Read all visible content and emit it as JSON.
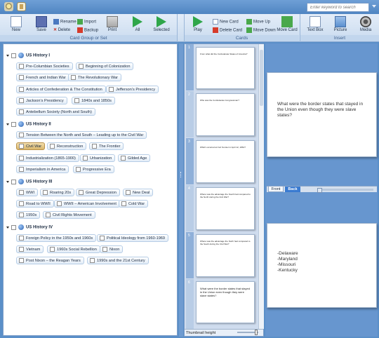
{
  "titlebar": {
    "search_placeholder": "Enter keyword to search"
  },
  "ribbon": {
    "card_group": {
      "label": "Card Group or Set",
      "new": "New",
      "save": "Save",
      "rename": "Rename",
      "delete": "Delete",
      "import": "Import",
      "backup": "Backup",
      "print": "Print",
      "all": "All",
      "selected": "Selected"
    },
    "cards": {
      "label": "Cards",
      "play": "Play",
      "new_card": "New Card",
      "delete_card": "Delete Card",
      "move_up": "Move Up",
      "move_down": "Move Down",
      "move_card": "Move Card"
    },
    "insert": {
      "label": "Insert",
      "text_box": "Text Box",
      "picture": "Picture",
      "media": "Media"
    }
  },
  "groups": [
    {
      "title": "US History I",
      "items": [
        "Pre-Columbian Societies",
        "Beginning of Colonization",
        "French and Indian War",
        "The Revolutionary War",
        "Articles of Confederation & The Constitution",
        "Jefferson's Presidency",
        "Jackson's Presidency",
        "1840s and 1850s",
        "Antebellum Society (North and South)"
      ]
    },
    {
      "title": "US History II",
      "items": [
        "Tension Between the North and South – Leading up to the Civil War",
        "Civil War",
        "Reconstruction",
        "The Frontier",
        "Industrialization (1865-1900)",
        "Urbanization",
        "Gilded Age",
        "Imperialism in America",
        "Progressive Era"
      ]
    },
    {
      "title": "US History III",
      "items": [
        "WWI",
        "Roaring 20s",
        "Great Depression",
        "New Deal",
        "Road to WWII",
        "WWII – American Involvement",
        "Cold War",
        "1950s",
        "Civil Rights Movement"
      ]
    },
    {
      "title": "US History IV",
      "items": [
        "Foreign Policy in the 1950s and 1960s",
        "Political Ideology from 1960-1969",
        "Vietnam",
        "1960s Social Rebellion",
        "Nixon",
        "Post Nixon – the Reagan Years",
        "1990s and the 21st Century"
      ]
    }
  ],
  "selected_item": "Civil War",
  "thumbnails": [
    {
      "num": "1",
      "text": "From what did the Confederate States of America?"
    },
    {
      "num": "2",
      "text": "Who was the Confederate Congressman?"
    },
    {
      "num": "3",
      "text": "Which occurred at Fort Sumter in April 12, 1861?"
    },
    {
      "num": "4",
      "text": "Where was the advantage the South had compared to the North during the Civil War?"
    },
    {
      "num": "5",
      "text": "Where was the advantage the North had compared to the South during the Civil War?"
    },
    {
      "num": "6",
      "text": "What were the border states that stayed in the Union even though they were slave states?"
    }
  ],
  "thumb_height_label": "Thumbnail height",
  "editor": {
    "front_text": "What were the border states that stayed in the Union even though they were slave states?",
    "back_text": "-Delaware\n-Maryland\n-Missouri\n-Kentucky",
    "tab_front": "Front",
    "tab_back": "Back"
  },
  "colors": {
    "accent": "#3a7bd1",
    "selected_tag": "#d9b66a",
    "background": "#5b8fc8"
  }
}
